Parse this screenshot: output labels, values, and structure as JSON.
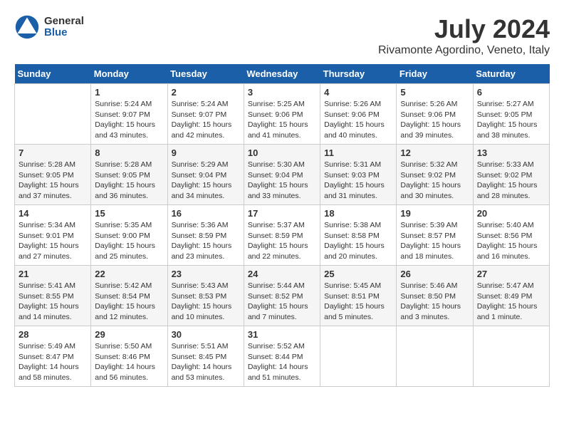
{
  "header": {
    "logo_line1": "General",
    "logo_line2": "Blue",
    "title": "July 2024",
    "location": "Rivamonte Agordino, Veneto, Italy"
  },
  "days_of_week": [
    "Sunday",
    "Monday",
    "Tuesday",
    "Wednesday",
    "Thursday",
    "Friday",
    "Saturday"
  ],
  "weeks": [
    [
      {
        "day": "",
        "text": ""
      },
      {
        "day": "1",
        "text": "Sunrise: 5:24 AM\nSunset: 9:07 PM\nDaylight: 15 hours\nand 43 minutes."
      },
      {
        "day": "2",
        "text": "Sunrise: 5:24 AM\nSunset: 9:07 PM\nDaylight: 15 hours\nand 42 minutes."
      },
      {
        "day": "3",
        "text": "Sunrise: 5:25 AM\nSunset: 9:06 PM\nDaylight: 15 hours\nand 41 minutes."
      },
      {
        "day": "4",
        "text": "Sunrise: 5:26 AM\nSunset: 9:06 PM\nDaylight: 15 hours\nand 40 minutes."
      },
      {
        "day": "5",
        "text": "Sunrise: 5:26 AM\nSunset: 9:06 PM\nDaylight: 15 hours\nand 39 minutes."
      },
      {
        "day": "6",
        "text": "Sunrise: 5:27 AM\nSunset: 9:05 PM\nDaylight: 15 hours\nand 38 minutes."
      }
    ],
    [
      {
        "day": "7",
        "text": "Sunrise: 5:28 AM\nSunset: 9:05 PM\nDaylight: 15 hours\nand 37 minutes."
      },
      {
        "day": "8",
        "text": "Sunrise: 5:28 AM\nSunset: 9:05 PM\nDaylight: 15 hours\nand 36 minutes."
      },
      {
        "day": "9",
        "text": "Sunrise: 5:29 AM\nSunset: 9:04 PM\nDaylight: 15 hours\nand 34 minutes."
      },
      {
        "day": "10",
        "text": "Sunrise: 5:30 AM\nSunset: 9:04 PM\nDaylight: 15 hours\nand 33 minutes."
      },
      {
        "day": "11",
        "text": "Sunrise: 5:31 AM\nSunset: 9:03 PM\nDaylight: 15 hours\nand 31 minutes."
      },
      {
        "day": "12",
        "text": "Sunrise: 5:32 AM\nSunset: 9:02 PM\nDaylight: 15 hours\nand 30 minutes."
      },
      {
        "day": "13",
        "text": "Sunrise: 5:33 AM\nSunset: 9:02 PM\nDaylight: 15 hours\nand 28 minutes."
      }
    ],
    [
      {
        "day": "14",
        "text": "Sunrise: 5:34 AM\nSunset: 9:01 PM\nDaylight: 15 hours\nand 27 minutes."
      },
      {
        "day": "15",
        "text": "Sunrise: 5:35 AM\nSunset: 9:00 PM\nDaylight: 15 hours\nand 25 minutes."
      },
      {
        "day": "16",
        "text": "Sunrise: 5:36 AM\nSunset: 8:59 PM\nDaylight: 15 hours\nand 23 minutes."
      },
      {
        "day": "17",
        "text": "Sunrise: 5:37 AM\nSunset: 8:59 PM\nDaylight: 15 hours\nand 22 minutes."
      },
      {
        "day": "18",
        "text": "Sunrise: 5:38 AM\nSunset: 8:58 PM\nDaylight: 15 hours\nand 20 minutes."
      },
      {
        "day": "19",
        "text": "Sunrise: 5:39 AM\nSunset: 8:57 PM\nDaylight: 15 hours\nand 18 minutes."
      },
      {
        "day": "20",
        "text": "Sunrise: 5:40 AM\nSunset: 8:56 PM\nDaylight: 15 hours\nand 16 minutes."
      }
    ],
    [
      {
        "day": "21",
        "text": "Sunrise: 5:41 AM\nSunset: 8:55 PM\nDaylight: 15 hours\nand 14 minutes."
      },
      {
        "day": "22",
        "text": "Sunrise: 5:42 AM\nSunset: 8:54 PM\nDaylight: 15 hours\nand 12 minutes."
      },
      {
        "day": "23",
        "text": "Sunrise: 5:43 AM\nSunset: 8:53 PM\nDaylight: 15 hours\nand 10 minutes."
      },
      {
        "day": "24",
        "text": "Sunrise: 5:44 AM\nSunset: 8:52 PM\nDaylight: 15 hours\nand 7 minutes."
      },
      {
        "day": "25",
        "text": "Sunrise: 5:45 AM\nSunset: 8:51 PM\nDaylight: 15 hours\nand 5 minutes."
      },
      {
        "day": "26",
        "text": "Sunrise: 5:46 AM\nSunset: 8:50 PM\nDaylight: 15 hours\nand 3 minutes."
      },
      {
        "day": "27",
        "text": "Sunrise: 5:47 AM\nSunset: 8:49 PM\nDaylight: 15 hours\nand 1 minute."
      }
    ],
    [
      {
        "day": "28",
        "text": "Sunrise: 5:49 AM\nSunset: 8:47 PM\nDaylight: 14 hours\nand 58 minutes."
      },
      {
        "day": "29",
        "text": "Sunrise: 5:50 AM\nSunset: 8:46 PM\nDaylight: 14 hours\nand 56 minutes."
      },
      {
        "day": "30",
        "text": "Sunrise: 5:51 AM\nSunset: 8:45 PM\nDaylight: 14 hours\nand 53 minutes."
      },
      {
        "day": "31",
        "text": "Sunrise: 5:52 AM\nSunset: 8:44 PM\nDaylight: 14 hours\nand 51 minutes."
      },
      {
        "day": "",
        "text": ""
      },
      {
        "day": "",
        "text": ""
      },
      {
        "day": "",
        "text": ""
      }
    ]
  ]
}
